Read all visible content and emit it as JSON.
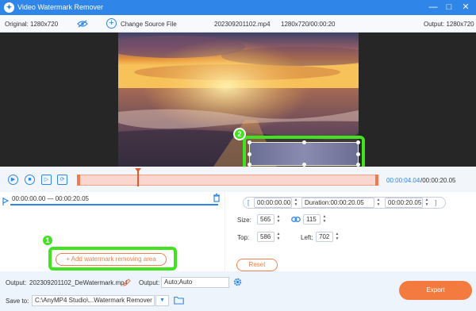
{
  "window": {
    "title": "Video Watermark Remover",
    "minimize_glyph": "—",
    "restore_glyph": "□",
    "close_glyph": "✕"
  },
  "infobar": {
    "original": "Original: 1280x720",
    "change_source": "Change Source File",
    "filename": "202309201102.mp4",
    "resolution_duration": "1280x720/00:00:20",
    "output": "Output: 1280x720"
  },
  "player": {
    "current_time": "00:00:04.04",
    "total_time": "/00:00:20.05",
    "playhead_fraction": 0.2
  },
  "segment": {
    "range": "00:00:00.00 — 00:00:20.05",
    "add_area_label": "Add watermark removing area",
    "add_area_plus": "+"
  },
  "area": {
    "start_bracket": "[",
    "start_time": "00:00:00.00",
    "duration": "Duration:00:00:20.05",
    "end_time": "00:00:20.05",
    "end_bracket": "]",
    "size_label": "Size:",
    "width": "565",
    "height": "115",
    "top_label": "Top:",
    "top": "586",
    "left_label": "Left:",
    "left": "702",
    "reset_label": "Reset"
  },
  "export": {
    "output_label": "Output:",
    "output_file": "202309201102_DeWatermark.mp4",
    "output_label2": "Output:",
    "output_format": "Auto;Auto",
    "save_to_label": "Save to:",
    "save_path": "C:\\AnyMP4 Studio\\...Watermark Remover",
    "export_label": "Export"
  },
  "annotations": {
    "badge1": "1",
    "badge2": "2"
  },
  "colors": {
    "titlebar": "#2f86e8",
    "accent_orange": "#f37b3f",
    "highlight_green": "#42e221"
  },
  "icons": [
    "app-logo-icon",
    "eye-slash-icon",
    "plus-circle-icon",
    "play-icon",
    "stop-icon",
    "next-frame-icon",
    "loop-icon",
    "trash-icon",
    "link-icon",
    "edit-icon",
    "gear-icon",
    "chevron-down-icon",
    "folder-icon"
  ]
}
